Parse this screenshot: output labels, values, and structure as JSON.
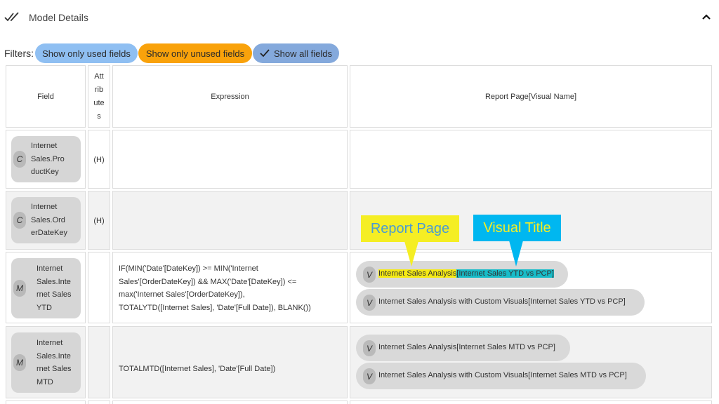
{
  "header": {
    "title": "Model Details",
    "left_icon": "double-check-icon",
    "right_icon": "chevron-up-icon"
  },
  "filters": {
    "label": "Filters:",
    "chips": [
      {
        "label": "Show only used fields",
        "color": "#8fbff2"
      },
      {
        "label": "Show only unused fields",
        "color": "#f9a20b"
      },
      {
        "label": "Show all fields",
        "color": "#84a9dc",
        "selected": true
      }
    ]
  },
  "table": {
    "columns": {
      "field": "Field",
      "attributes": [
        "Att",
        "rib",
        "ute",
        "s"
      ],
      "expression": "Expression",
      "report": "Report Page[Visual Name]"
    },
    "rows": [
      {
        "type": "C",
        "name_lines": [
          "Internet",
          "Sales.Pro",
          "ductKey"
        ],
        "attributes": "(H)",
        "expression_lines": [],
        "visuals": []
      },
      {
        "type": "C",
        "name_lines": [
          "Internet",
          "Sales.Ord",
          "erDateKey"
        ],
        "attributes": "(H)",
        "expression_lines": [],
        "visuals": []
      },
      {
        "type": "M",
        "name_lines": [
          "Internet",
          "Sales.Inte",
          "rnet Sales",
          "YTD"
        ],
        "attributes": "",
        "expression_lines": [
          "IF(MIN('Date'[DateKey]) >= MIN('Internet",
          "Sales'[OrderDateKey]) && MAX('Date'[DateKey]) <=",
          "max('Internet Sales'[OrderDateKey]),",
          "TOTALYTD([Internet Sales], 'Date'[Full Date]), BLANK())"
        ],
        "visuals": [
          {
            "type": "V",
            "page": "Internet Sales Analysis",
            "visual": "[Internet Sales YTD vs PCP]"
          },
          {
            "type": "V",
            "text": "Internet Sales Analysis with Custom Visuals[Internet Sales YTD vs PCP]"
          }
        ]
      },
      {
        "type": "M",
        "name_lines": [
          "Internet",
          "Sales.Inte",
          "rnet Sales",
          "MTD"
        ],
        "attributes": "",
        "expression_lines": [
          "TOTALMTD([Internet Sales], 'Date'[Full Date])"
        ],
        "visuals": [
          {
            "type": "V",
            "text": "Internet Sales Analysis[Internet Sales MTD vs PCP]"
          },
          {
            "type": "V",
            "text": "Internet Sales Analysis with Custom Visuals[Internet Sales MTD vs PCP]"
          }
        ]
      }
    ]
  },
  "annotations": {
    "report_page": "Report Page",
    "visual_title": "Visual Title"
  },
  "colors": {
    "callout_yellow": "#f5ee24",
    "callout_cyan": "#00b7f0",
    "row_shade": "#f2f2f2"
  }
}
